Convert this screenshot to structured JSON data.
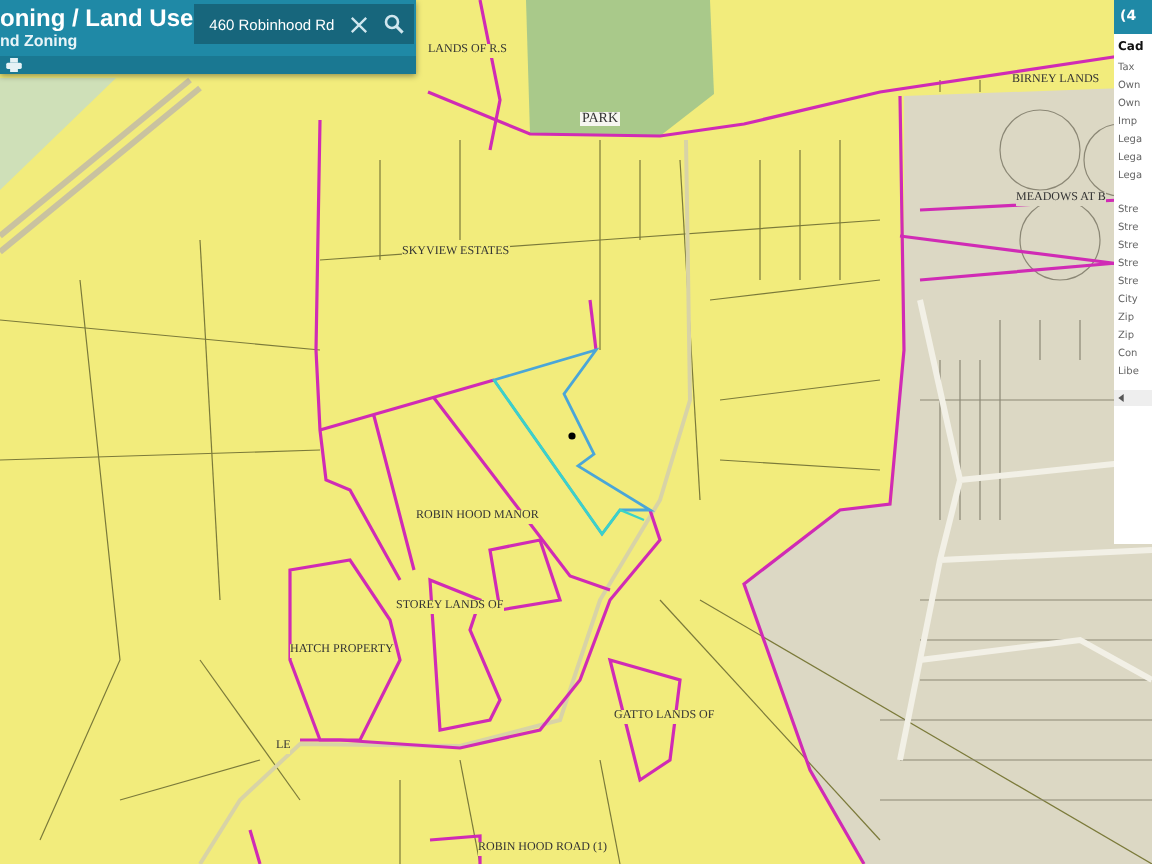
{
  "header": {
    "title": "oning / Land Use",
    "subtitle": "nd Zoning"
  },
  "search": {
    "value": "460 Robinhood Rd"
  },
  "map": {
    "labels": [
      {
        "text": "LANDS OF R.S"
      },
      {
        "text": "PARK"
      },
      {
        "text": "BIRNEY LANDS"
      },
      {
        "text": "MEADOWS AT B"
      },
      {
        "text": "SKYVIEW ESTATES"
      },
      {
        "text": "ROBIN HOOD MANOR"
      },
      {
        "text": "STOREY LANDS OF"
      },
      {
        "text": "HATCH PROPERTY"
      },
      {
        "text": "GATTO LANDS OF"
      },
      {
        "text": "LE"
      },
      {
        "text": "ROBIN HOOD ROAD (1)"
      }
    ]
  },
  "details_panel": {
    "header": "(4",
    "title": "Cad",
    "field_groups": [
      [
        "Tax",
        "Own",
        "Own",
        "Imp",
        "Lega",
        "Lega",
        "Lega"
      ],
      [
        "Stre",
        "Stre",
        "Stre",
        "Stre",
        "Stre",
        "City",
        "Zip",
        "Zip",
        "Con",
        "Libe"
      ]
    ]
  }
}
